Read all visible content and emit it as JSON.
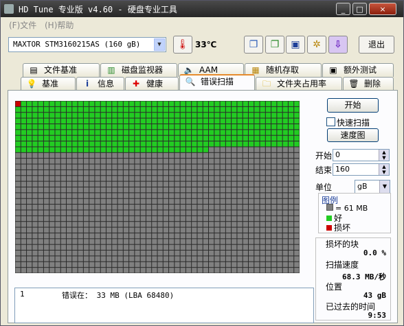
{
  "window": {
    "title": "HD Tune 专业版 v4.60 - 硬盘专业工具"
  },
  "titlebar_buttons": [
    "_",
    "□",
    "×"
  ],
  "menu": {
    "items": [
      "(F)文件",
      "(H)帮助"
    ]
  },
  "toolbar": {
    "drive": "MAXTOR STM3160215AS (160 gB)",
    "temperature": "33℃",
    "exit_label": "退出",
    "tools": [
      "copy-text-icon",
      "copy-screenshot-icon",
      "save-icon",
      "options-icon",
      "download-icon"
    ]
  },
  "tabs_top": [
    {
      "label": "文件基准",
      "icon": "file-benchmark-icon"
    },
    {
      "label": "磁盘监视器",
      "icon": "disk-monitor-icon"
    },
    {
      "label": "AAM",
      "icon": "speaker-icon"
    },
    {
      "label": "随机存取",
      "icon": "random-access-icon"
    },
    {
      "label": "额外测试",
      "icon": "extra-tests-icon"
    }
  ],
  "tabs_bottom": [
    {
      "label": "基准",
      "icon": "lightbulb-icon"
    },
    {
      "label": "信息",
      "icon": "info-icon"
    },
    {
      "label": "健康",
      "icon": "health-cross-icon"
    },
    {
      "label": "错误扫描",
      "icon": "magnifier-icon",
      "active": true
    },
    {
      "label": "文件夹占用率",
      "icon": "folder-icon"
    },
    {
      "label": "删除",
      "icon": "trash-icon"
    }
  ],
  "scan": {
    "start_button": "开始",
    "quick_scan_label": "快速扫描",
    "quick_scan_checked": false,
    "speed_map_button": "速度图",
    "start_label": "开始",
    "start_value": "0",
    "end_label": "结束",
    "end_value": "160",
    "unit_label": "单位",
    "unit_value": "gB",
    "grid_cols": 50,
    "grid_rows": 30,
    "good_full_rows": 8,
    "good_partial_cols": 34,
    "damaged_blocks": 1,
    "colors": {
      "good": "#22cc22",
      "untested": "#808080",
      "damaged": "#cc0000"
    }
  },
  "legend": {
    "title": "图例",
    "block_size": "= 61 MB",
    "good": "好",
    "damaged": "损坏"
  },
  "stats": {
    "damaged_label": "损坏的块",
    "damaged_value": "0.0 %",
    "speed_label": "扫描速度",
    "speed_value": "68.3 MB/秒",
    "position_label": "位置",
    "position_value": "43 gB",
    "elapsed_label": "已过去的时间",
    "elapsed_value": "9:53"
  },
  "log": {
    "rows": [
      {
        "index": "1",
        "message": "错误在：  33 MB  (LBA 68480)"
      }
    ]
  }
}
